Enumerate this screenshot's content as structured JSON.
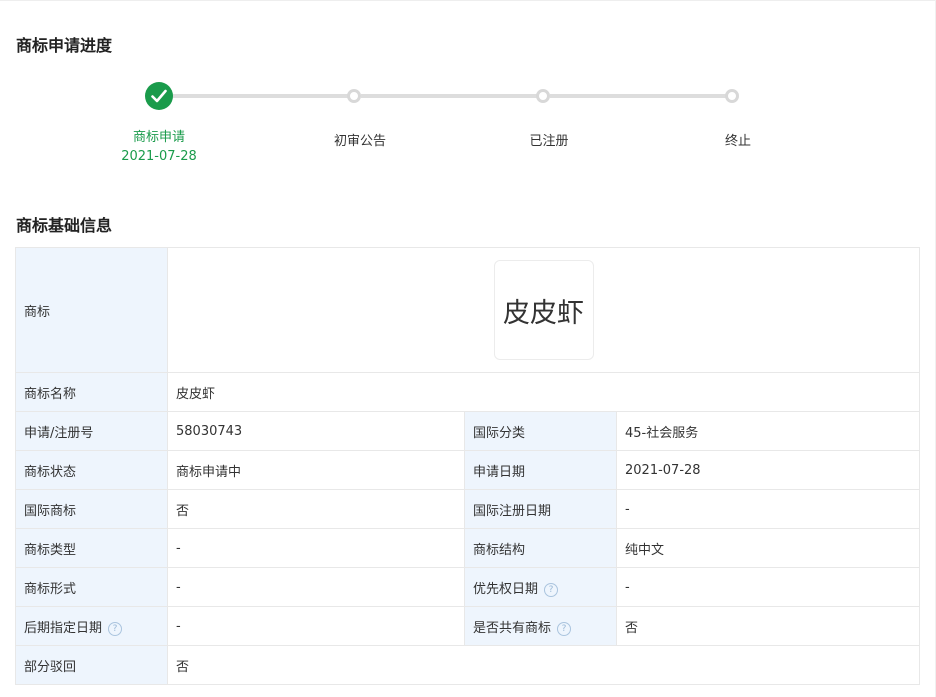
{
  "progress": {
    "title": "商标申请进度",
    "steps": [
      {
        "label": "商标申请",
        "date": "2021-07-28",
        "status": "done"
      },
      {
        "label": "初审公告",
        "status": "todo"
      },
      {
        "label": "已注册",
        "status": "todo"
      },
      {
        "label": "终止",
        "status": "todo"
      }
    ]
  },
  "basic": {
    "title": "商标基础信息",
    "trademark_label": "商标",
    "trademark_image_text": "皮皮虾",
    "name_label": "商标名称",
    "name_value": "皮皮虾",
    "reg_no_label": "申请/注册号",
    "reg_no_value": "58030743",
    "intl_class_label": "国际分类",
    "intl_class_value": "45-社会服务",
    "status_label": "商标状态",
    "status_value": "商标申请中",
    "apply_date_label": "申请日期",
    "apply_date_value": "2021-07-28",
    "intl_tm_label": "国际商标",
    "intl_tm_value": "否",
    "intl_reg_date_label": "国际注册日期",
    "intl_reg_date_value": "-",
    "type_label": "商标类型",
    "type_value": "-",
    "structure_label": "商标结构",
    "structure_value": "纯中文",
    "form_label": "商标形式",
    "form_value": "-",
    "priority_date_label": "优先权日期",
    "priority_date_value": "-",
    "later_date_label": "后期指定日期",
    "later_date_value": "-",
    "shared_label": "是否共有商标",
    "shared_value": "否",
    "partial_reject_label": "部分驳回",
    "partial_reject_value": "否"
  },
  "colors": {
    "accent_green": "#1a9b4b",
    "label_bg": "#eef5fd",
    "border": "#e8e8e8"
  }
}
